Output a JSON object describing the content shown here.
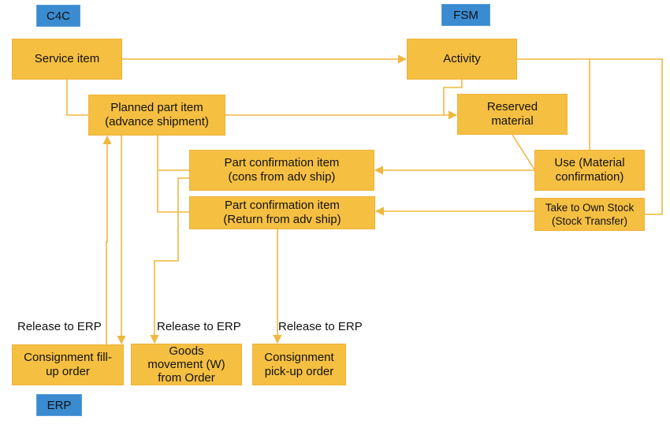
{
  "colors": {
    "box_fill": "#f5bf42",
    "connector": "#f0b840",
    "system_tag": "#3a8bd0"
  },
  "systems": {
    "c4c": "C4C",
    "fsm": "FSM",
    "erp": "ERP"
  },
  "nodes": {
    "service_item": "Service item",
    "activity": "Activity",
    "planned_part_l1": "Planned part item",
    "planned_part_l2": "(advance shipment)",
    "reserved_l1": "Reserved",
    "reserved_l2": "material",
    "pc_cons_l1": "Part confirmation item",
    "pc_cons_l2": "(cons from adv ship)",
    "pc_return_l1": "Part confirmation item",
    "pc_return_l2": "(Return from adv ship)",
    "use_l1": "Use (Material",
    "use_l2": "confirmation)",
    "take_l1": "Take to Own Stock",
    "take_l2": "(Stock Transfer)",
    "fillup_l1": "Consignment fill-",
    "fillup_l2": "up order",
    "goods_l1": "Goods",
    "goods_l2": "movement (W)",
    "goods_l3": "from Order",
    "pickup_l1": "Consignment",
    "pickup_l2": "pick-up order"
  },
  "edge_labels": [
    "Release to ERP",
    "Release to ERP",
    "Release to ERP"
  ]
}
